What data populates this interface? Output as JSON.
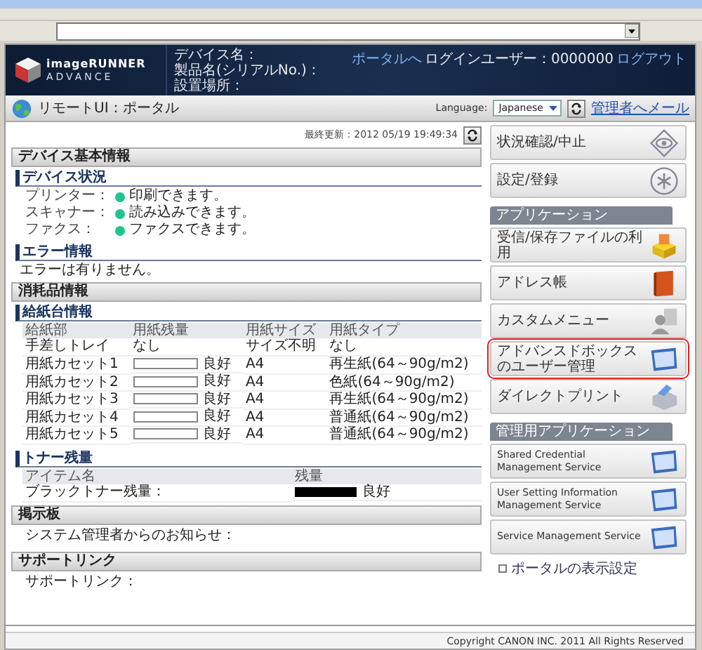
{
  "header": {
    "logo_line1": "imageRUNNER",
    "logo_line2": "ADVANCE",
    "device_fields": [
      "デバイス名：",
      "製品名(シリアルNo.)：",
      "設置場所："
    ],
    "portal_link": "ポータルへ",
    "login_label": "ログインユーザー：0000000",
    "logout_link": "ログアウト"
  },
  "titlebar": {
    "title": "リモートUI：ポータル",
    "language_label": "Language:",
    "language_value": "Japanese",
    "mail_link": "管理者へメール"
  },
  "last_updated": "最終更新：2012 05/19 19:49:34",
  "device_info": {
    "title": "デバイス基本情報",
    "status_heading": "デバイス状況",
    "status": [
      {
        "label": "プリンター：",
        "text": "印刷できます。"
      },
      {
        "label": "スキャナー：",
        "text": "読み込みできます。"
      },
      {
        "label": "ファクス：",
        "text": "ファクスできます。"
      }
    ],
    "error_heading": "エラー情報",
    "error_text": "エラーは有りません。"
  },
  "supplies": {
    "title": "消耗品情報",
    "paper_heading": "給紙台情報",
    "paper_columns": [
      "給紙部",
      "用紙残量",
      "用紙サイズ",
      "用紙タイプ"
    ],
    "paper_rows": [
      {
        "kind": "text",
        "source": "手差しトレイ",
        "remaining": "なし",
        "size": "サイズ不明",
        "type": "なし"
      },
      {
        "kind": "gauge",
        "source": "用紙カセット1",
        "remaining": "良好",
        "size": "A4",
        "type": "再生紙(64～90g/m2)"
      },
      {
        "kind": "gauge",
        "source": "用紙カセット2",
        "remaining": "良好",
        "size": "A4",
        "type": "色紙(64～90g/m2)"
      },
      {
        "kind": "gauge",
        "source": "用紙カセット3",
        "remaining": "良好",
        "size": "A4",
        "type": "再生紙(64～90g/m2)"
      },
      {
        "kind": "gauge",
        "source": "用紙カセット4",
        "remaining": "良好",
        "size": "A4",
        "type": "普通紙(64～90g/m2)"
      },
      {
        "kind": "gauge",
        "source": "用紙カセット5",
        "remaining": "良好",
        "size": "A4",
        "type": "普通紙(64～90g/m2)"
      }
    ],
    "toner_heading": "トナー残量",
    "toner_columns": [
      "アイテム名",
      "残量"
    ],
    "toner_rows": [
      {
        "name": "ブラックトナー残量：",
        "level": 1,
        "status": "良好"
      }
    ]
  },
  "bulletin": {
    "title": "掲示板",
    "text": "システム管理者からのお知らせ："
  },
  "support": {
    "title": "サポートリンク",
    "text": "サポートリンク："
  },
  "top_buttons": [
    {
      "label": "状況確認/中止"
    },
    {
      "label": "設定/登録"
    }
  ],
  "applications": {
    "title": "アプリケーション",
    "items": [
      {
        "label": "受信/保存ファイルの利用",
        "selected": false
      },
      {
        "label": "アドレス帳",
        "selected": false
      },
      {
        "label": "カスタムメニュー",
        "selected": false
      },
      {
        "label": "アドバンスドボックスのユーザー管理",
        "selected": true
      },
      {
        "label": "ダイレクトプリント",
        "selected": false
      }
    ]
  },
  "admin_applications": {
    "title": "管理用アプリケーション",
    "items": [
      {
        "label": "Shared Credential Management Service"
      },
      {
        "label": "User Setting Information Management Service"
      },
      {
        "label": "Service Management Service"
      }
    ]
  },
  "portal_settings": "ポータルの表示設定",
  "copyright": "Copyright CANON INC. 2011 All Rights Reserved"
}
